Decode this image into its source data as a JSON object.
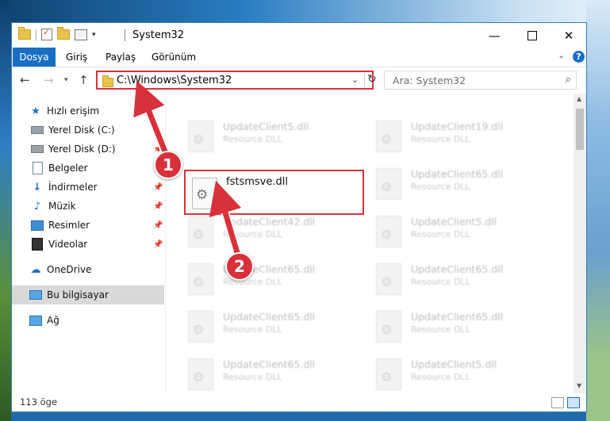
{
  "title_bar": {
    "title": "System32",
    "icons": [
      "folder-icon",
      "properties-check-icon",
      "new-folder-icon",
      "customize-icon",
      "dropdown-icon"
    ],
    "minimize_icon": "—",
    "close_icon": "✕"
  },
  "ribbon": {
    "tabs": [
      {
        "label": "Dosya",
        "active": true
      },
      {
        "label": "Giriş"
      },
      {
        "label": "Paylaş"
      },
      {
        "label": "Görünüm"
      }
    ],
    "help_label": "?"
  },
  "navigation": {
    "address": "C:\\Windows\\System32",
    "search_placeholder": "Ara: System32"
  },
  "sidebar": {
    "items": [
      {
        "label": "Hızlı erişim",
        "icon": "star-icon",
        "pinned": false
      },
      {
        "label": "Yerel Disk (C:)",
        "icon": "drive-icon",
        "pinned": false
      },
      {
        "label": "Yerel Disk (D:)",
        "icon": "drive-icon",
        "pinned": true
      },
      {
        "label": "Belgeler",
        "icon": "documents-icon",
        "pinned": true
      },
      {
        "label": "İndirmeler",
        "icon": "downloads-icon",
        "pinned": true
      },
      {
        "label": "Müzik",
        "icon": "music-icon",
        "pinned": true
      },
      {
        "label": "Resimler",
        "icon": "pictures-icon",
        "pinned": true
      },
      {
        "label": "Videolar",
        "icon": "videos-icon",
        "pinned": true
      },
      {
        "label": "OneDrive",
        "icon": "cloud-icon",
        "pinned": false
      },
      {
        "label": "Bu bilgisayar",
        "icon": "computer-icon",
        "selected": true
      },
      {
        "label": "Ağ",
        "icon": "network-icon",
        "pinned": false
      }
    ]
  },
  "files": {
    "left_column": [
      {
        "name": "UpdateClient5.dll",
        "type": "Resource DLL"
      },
      {
        "name": "fstsmsve.dll",
        "highlighted": true
      },
      {
        "name": "UpdateClient42.dll",
        "type": "Resource DLL"
      },
      {
        "name": "UpdateClient65.dll",
        "type": "Resource DLL"
      },
      {
        "name": "UpdateClient65.dll",
        "type": "Resource DLL"
      },
      {
        "name": "UpdateClient65.dll",
        "type": "Resource DLL"
      }
    ],
    "right_column": [
      {
        "name": "UpdateClient19.dll",
        "type": "Resource DLL"
      },
      {
        "name": "UpdateClient65.dll",
        "type": "Resource DLL"
      },
      {
        "name": "UpdateClient5.dll",
        "type": "Resource DLL"
      },
      {
        "name": "UpdateClient65.dll",
        "type": "Resource DLL"
      },
      {
        "name": "UpdateClient65.dll",
        "type": "Resource DLL"
      },
      {
        "name": "UpdateClient5.dll",
        "type": "Resource DLL"
      }
    ]
  },
  "status": {
    "item_count": "113 öge"
  },
  "annotations": {
    "step1": "1",
    "step2": "2",
    "color": "#d9313b"
  }
}
